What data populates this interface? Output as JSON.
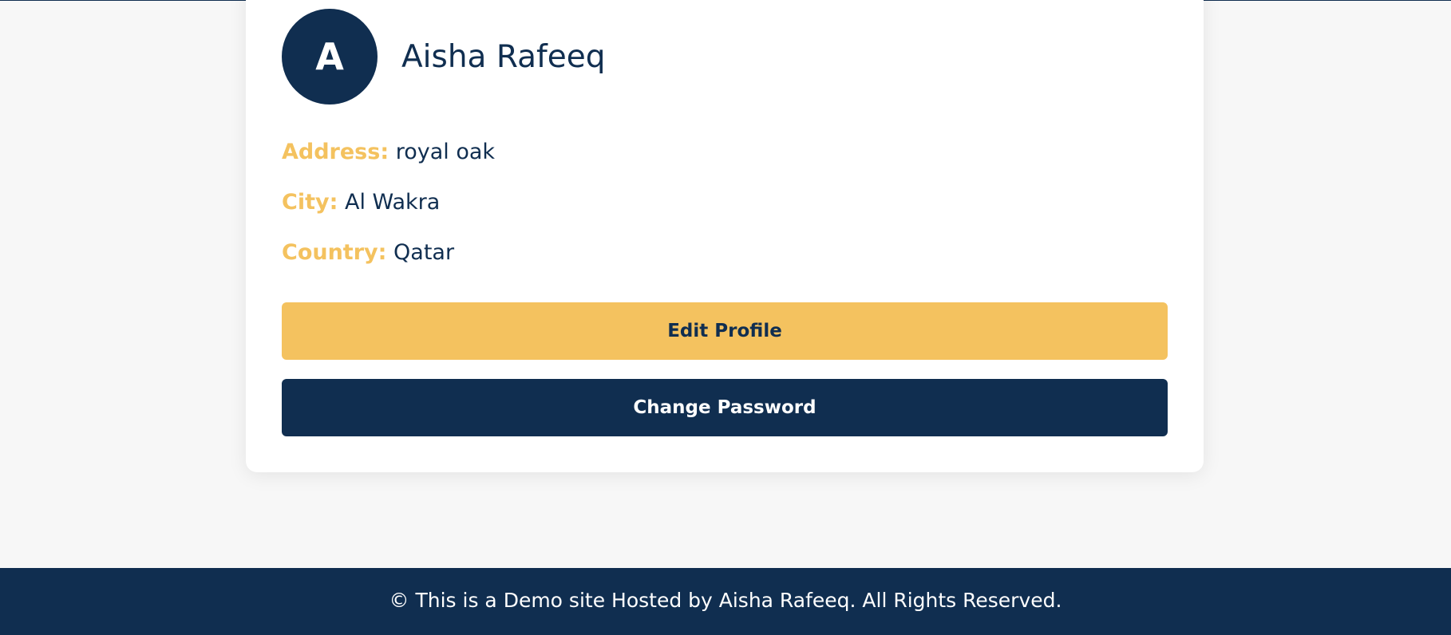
{
  "profile": {
    "avatar_initial": "A",
    "name": "Aisha Rafeeq"
  },
  "details": [
    {
      "label": "Address:",
      "value": "royal oak"
    },
    {
      "label": "City:",
      "value": "Al Wakra"
    },
    {
      "label": "Country:",
      "value": "Qatar"
    }
  ],
  "actions": {
    "edit_profile_label": "Edit Profile",
    "change_password_label": "Change Password"
  },
  "footer": {
    "text": "© This is a Demo site Hosted by Aisha Rafeeq. All Rights Reserved."
  },
  "colors": {
    "primary": "#102e50",
    "accent": "#f4c25f",
    "background": "#f7f7f7",
    "card": "#ffffff"
  }
}
